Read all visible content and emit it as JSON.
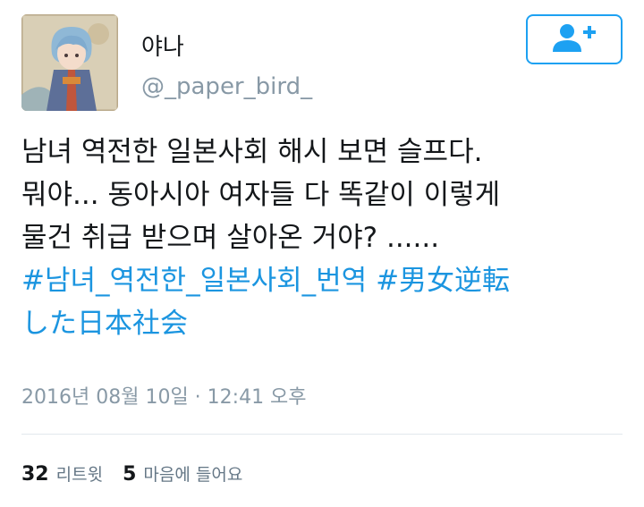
{
  "profile": {
    "display_name": "야나",
    "handle": "@_paper_bird_"
  },
  "tweet": {
    "lines": [
      "남녀 역전한 일본사회 해시 보면 슬프다.",
      "뭐야... 동아시아 여자들 다 똑같이 이렇게",
      "물건 취급 받으며 살아온 거야? ......"
    ],
    "hashtag_1": "#남녀_역전한_일본사회_번역",
    "hashtag_2a": "#男女逆転",
    "hashtag_2b": "した日本社会",
    "timestamp": "2016년 08월 10일 · 12:41 오후"
  },
  "stats": {
    "retweets_count": "32",
    "retweets_label": "리트윗",
    "likes_count": "5",
    "likes_label": "마음에 들어요"
  },
  "colors": {
    "link": "#1b95e0",
    "follow_border": "#1da1f2",
    "secondary_text": "#8899a6"
  },
  "icons": {
    "follow": "add-user-icon"
  }
}
